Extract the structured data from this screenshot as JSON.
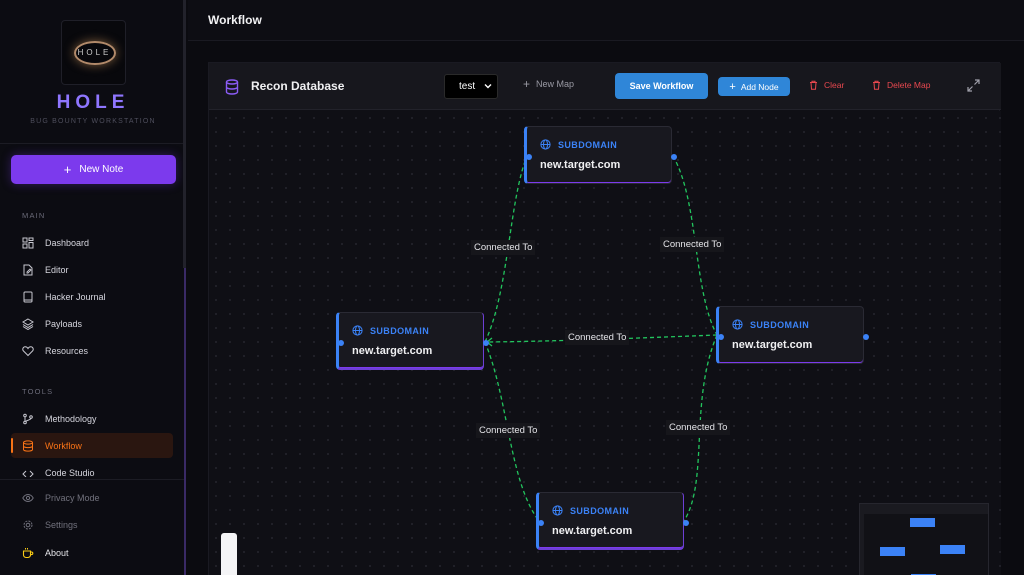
{
  "app": {
    "logo_text": "HOLE",
    "brand_title": "HOLE",
    "brand_subtitle": "BUG BOUNTY WORKSTATION"
  },
  "sidebar": {
    "new_note_label": "New Note",
    "main_section_label": "MAIN",
    "main_items": [
      {
        "label": "Dashboard",
        "icon": "dashboard-icon"
      },
      {
        "label": "Editor",
        "icon": "edit-icon"
      },
      {
        "label": "Hacker Journal",
        "icon": "book-icon"
      },
      {
        "label": "Payloads",
        "icon": "layers-icon"
      },
      {
        "label": "Resources",
        "icon": "heart-icon"
      }
    ],
    "tools_section_label": "TOOLS",
    "tools_items": [
      {
        "label": "Methodology",
        "icon": "git-branch-icon"
      },
      {
        "label": "Workflow",
        "icon": "database-icon",
        "active": true
      },
      {
        "label": "Code Studio",
        "icon": "code-icon"
      }
    ],
    "footer_items": [
      {
        "label": "Privacy Mode",
        "icon": "eye-icon"
      },
      {
        "label": "Settings",
        "icon": "gear-icon"
      },
      {
        "label": "About",
        "icon": "coffee-icon"
      }
    ]
  },
  "header": {
    "title": "Workflow"
  },
  "toolbar": {
    "title": "Recon Database",
    "selected_map": "test",
    "new_map_label": "New Map",
    "save_label": "Save Workflow",
    "add_node_label": "Add Node",
    "clear_label": "Clear",
    "delete_map_label": "Delete Map"
  },
  "graph": {
    "nodes": [
      {
        "id": "top",
        "type": "SUBDOMAIN",
        "value": "new.target.com"
      },
      {
        "id": "left",
        "type": "SUBDOMAIN",
        "value": "new.target.com"
      },
      {
        "id": "right",
        "type": "SUBDOMAIN",
        "value": "new.target.com"
      },
      {
        "id": "bottom",
        "type": "SUBDOMAIN",
        "value": "new.target.com"
      }
    ],
    "edges": [
      {
        "from": "left",
        "to": "top",
        "label": "Connected To"
      },
      {
        "from": "top",
        "to": "right",
        "label": "Connected To"
      },
      {
        "from": "right",
        "to": "left",
        "label": "Connected To"
      },
      {
        "from": "left",
        "to": "bottom",
        "label": "Connected To"
      },
      {
        "from": "right",
        "to": "bottom",
        "label": "Connected To"
      }
    ]
  },
  "colors": {
    "accent_purple": "#7c3aed",
    "accent_blue": "#3b82f6",
    "active_orange": "#f97316",
    "danger_red": "#e8484f",
    "edge_green": "#22c55e"
  }
}
